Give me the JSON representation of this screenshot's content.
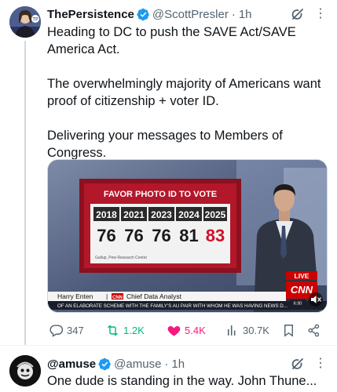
{
  "tweet": {
    "author_name": "ThePersistence",
    "handle": "@ScottPresler",
    "separator": "·",
    "time": "1h",
    "paragraphs": [
      "Heading to DC to push the SAVE Act/SAVE America Act.",
      "The overwhelmingly majority of Americans want proof of citizenship + voter ID.",
      "Delivering your messages to Members of Congress."
    ],
    "media": {
      "board_title": "FAVOR PHOTO ID TO VOTE",
      "years": [
        "2018",
        "2021",
        "2023",
        "2024",
        "2025"
      ],
      "percents": [
        "76",
        "76",
        "76",
        "81",
        "83"
      ],
      "source_note": "Gallup, Pew Research Center",
      "live_label": "LIVE",
      "network": "CNN",
      "clock": "6:30",
      "lower_third_name": "Harry Enten",
      "lower_third_sep": "|",
      "lower_third_network": "CNN",
      "lower_third_title": "Chief Data Analyst",
      "ticker": "OF AN ELABORATE SCHEME WITH THE FAMILY'S AU PAIR WITH WHOM HE WAS HAVING NEWS D...",
      "colors": {
        "board_red": "#b3172a",
        "board_frame": "#8b1020",
        "live_red": "#cc0000",
        "suit": "#2f3542"
      }
    },
    "actions": {
      "replies": "347",
      "reposts": "1.2K",
      "likes": "5.4K",
      "views": "30.7K"
    },
    "icons": [
      "verified-badge-icon",
      "grok-icon",
      "more-icon",
      "reply-icon",
      "repost-icon",
      "heart-icon",
      "views-icon",
      "bookmark-icon",
      "share-icon"
    ]
  },
  "reply": {
    "author_name": "@amuse",
    "handle": "@amuse",
    "separator": "·",
    "time": "1h",
    "text": "One dude is standing in the way. John Thune..."
  },
  "colors": {
    "text": "#0f1419",
    "muted": "#536471",
    "verified": "#1d9bf0",
    "repost_active": "#00ba7c",
    "like_active": "#f91880",
    "divider": "#eff3f4"
  }
}
